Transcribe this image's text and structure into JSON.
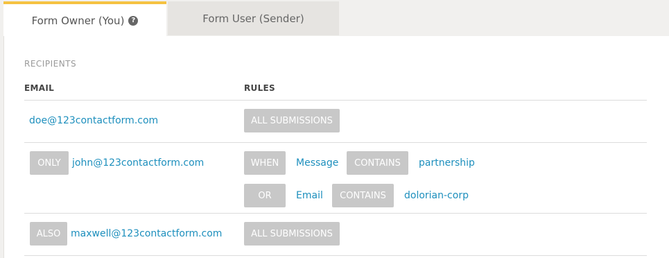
{
  "tabs": {
    "owner_label": "Form Owner (You)",
    "help_glyph": "?",
    "user_label": "Form User (Sender)"
  },
  "section": {
    "title": "RECIPIENTS",
    "col_email": "EMAIL",
    "col_rules": "RULES"
  },
  "rows": [
    {
      "email": "doe@123contactform.com",
      "rule_chip": "ALL SUBMISSIONS"
    },
    {
      "prefix": "ONLY",
      "email": "john@123contactform.com",
      "conditions": [
        {
          "join": "WHEN",
          "field": "Message",
          "operator": "CONTAINS",
          "value": "partnership"
        },
        {
          "join": "OR",
          "field": "Email",
          "operator": "CONTAINS",
          "value": "dolorian-corp"
        }
      ]
    },
    {
      "prefix": "ALSO",
      "email": "maxwell@123contactform.com",
      "rule_chip": "ALL SUBMISSIONS"
    }
  ],
  "colors": {
    "accent_tab": "#f5c242",
    "link": "#1d8fbd",
    "chip_bg": "#c8c8c8"
  }
}
